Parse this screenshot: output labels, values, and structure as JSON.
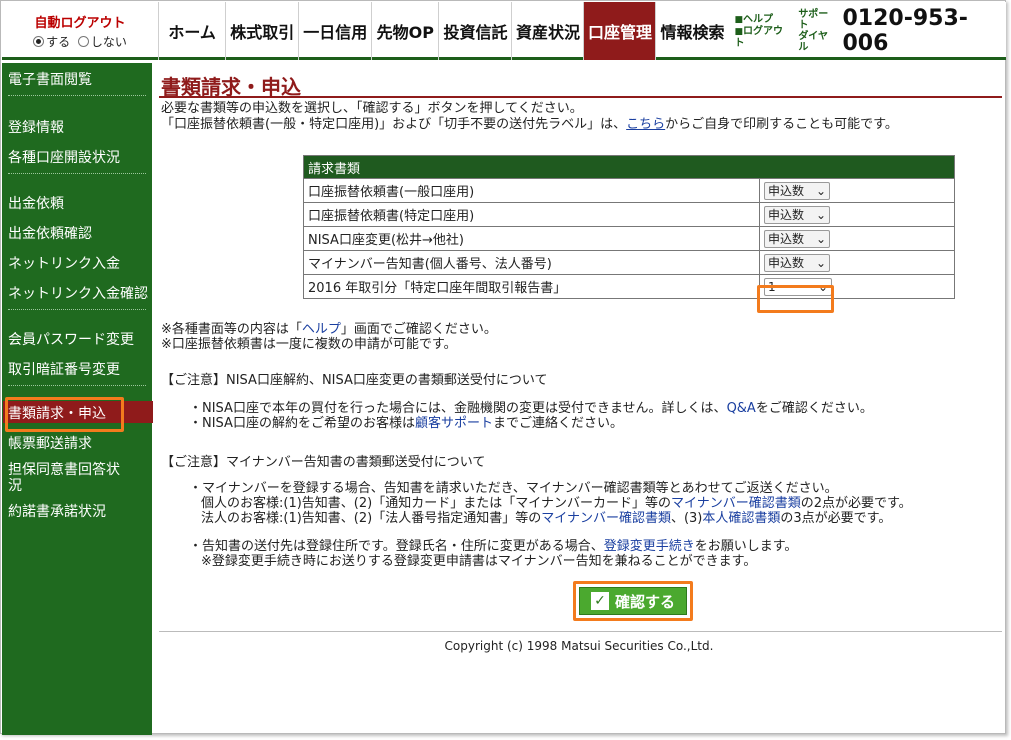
{
  "header": {
    "auto_logout_title": "自動ログアウト",
    "auto_logout_on": "する",
    "auto_logout_off": "しない",
    "nav": [
      "ホーム",
      "株式取引",
      "一日信用",
      "先物OP",
      "投資信託",
      "資産状況",
      "口座管理",
      "情報検索"
    ],
    "active_nav": "口座管理",
    "help_label": "ヘルプ",
    "logout_label": "ログアウト",
    "support_line1": "サポート",
    "support_line2": "ダイヤル",
    "phone": "0120-953-006"
  },
  "sidebar": {
    "items": [
      "電子書面閲覧",
      "登録情報",
      "各種口座開設状況",
      "出金依頼",
      "出金依頼確認",
      "ネットリンク入金",
      "ネットリンク入金確認",
      "会員パスワード変更",
      "取引暗証番号変更",
      "書類請求・申込",
      "帳票郵送請求",
      "担保同意書回答状",
      "況",
      "約諾書承諾状況"
    ],
    "active": "書類請求・申込"
  },
  "main": {
    "title": "書類請求・申込",
    "intro_line1": "必要な書類等の申込数を選択し、「確認する」ボタンを押してください。",
    "intro_line2_a": "「口座振替依頼書(一般・特定口座用)」および「切手不要の送付先ラベル」は、",
    "intro_link": "こちら",
    "intro_line2_b": "からご自身で印刷することも可能です。",
    "table_header": "請求書類",
    "rows": [
      {
        "label": "口座振替依頼書(一般口座用)",
        "value": "申込数"
      },
      {
        "label": "口座振替依頼書(特定口座用)",
        "value": "申込数"
      },
      {
        "label": "NISA口座変更(松井→他社)",
        "value": "申込数"
      },
      {
        "label": "マイナンバー告知書(個人番号、法人番号)",
        "value": "申込数"
      },
      {
        "label": "2016 年取引分「特定口座年間取引報告書」",
        "value": "1"
      }
    ],
    "note1_a": "※各種書面等の内容は「",
    "note1_link": "ヘルプ",
    "note1_b": "」画面でご確認ください。",
    "note2": "※口座振替依頼書は一度に複数の申請が可能です。",
    "caution1": "【ご注意】NISA口座解約、NISA口座変更の書類郵送受付について",
    "b1_a": "・NISA口座で本年の買付を行った場合には、金融機関の変更は受付できません。詳しくは、",
    "b1_link": "Q&A",
    "b1_b": "をご確認ください。",
    "b2_a": "・NISA口座の解約をご希望のお客様は",
    "b2_link": "顧客サポート",
    "b2_b": "までご連絡ください。",
    "caution2": "【ご注意】マイナンバー告知書の書類郵送受付について",
    "b3": "・マイナンバーを登録する場合、告知書を請求いただき、マイナンバー確認書類等とあわせてご返送ください。",
    "b3_ind_a": "個人のお客様:(1)告知書、(2)「通知カード」または「マイナンバーカード」等の",
    "b3_ind_link": "マイナンバー確認書類",
    "b3_ind_b": "の2点が必要です。",
    "b3_corp_a": "法人のお客様:(1)告知書、(2)「法人番号指定通知書」等の",
    "b3_corp_link1": "マイナンバー確認書類",
    "b3_corp_mid": "、(3)",
    "b3_corp_link2": "本人確認書類",
    "b3_corp_b": "の3点が必要です。",
    "b4_a": "・告知書の送付先は登録住所です。登録氏名・住所に変更がある場合、",
    "b4_link": "登録変更手続き",
    "b4_b": "をお願いします。",
    "b4_note": "※登録変更手続き時にお送りする登録変更申請書はマイナンバー告知を兼ねることができます。",
    "confirm_label": "確認する",
    "copyright": "Copyright (c) 1998 Matsui Securities Co.,Ltd."
  },
  "colors": {
    "brand_green": "#1f6a1f",
    "active_red": "#8f1b1b",
    "highlight_orange": "#f37b1d",
    "button_green": "#4ba92f"
  }
}
